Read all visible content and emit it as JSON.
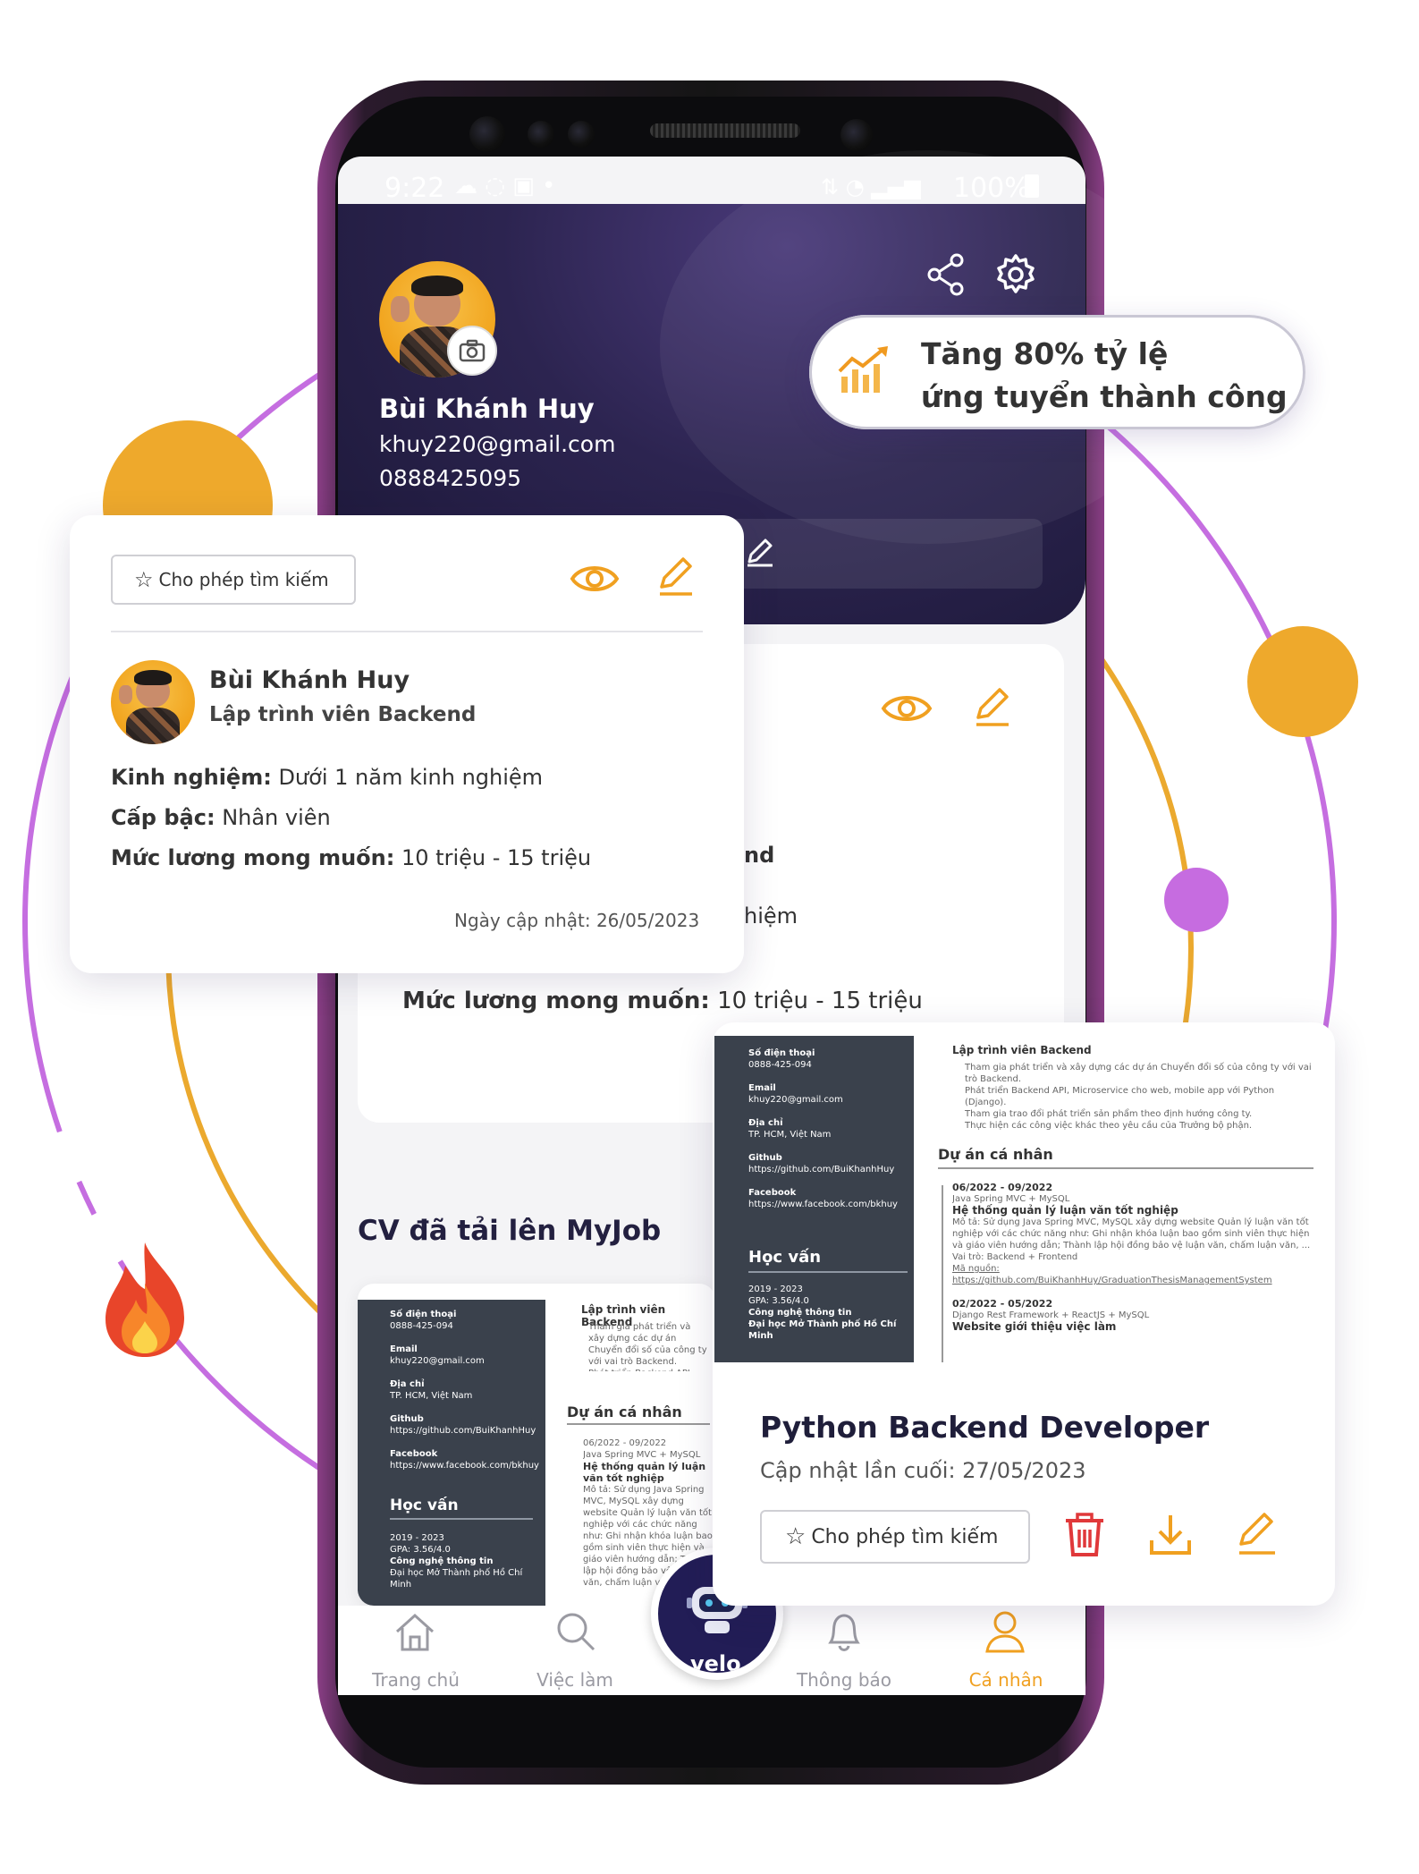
{
  "status_bar": {
    "time": "9:22",
    "right_text": "100%"
  },
  "profile_header": {
    "name": "Bùi Khánh Huy",
    "email": "khuy220@gmail.com",
    "phone": "0888425095"
  },
  "boost_badge": {
    "line1": "Tăng 80% tỷ lệ",
    "line2": "ứng tuyển thành công"
  },
  "profile_card": {
    "search_toggle_label": "Cho phép tìm kiếm",
    "name": "Bùi Khánh Huy",
    "position": "Lập trình viên Backend",
    "experience_label": "Kinh nghiệm:",
    "experience_value": "Dưới 1 năm kinh nghiệm",
    "level_label": "Cấp bậc:",
    "level_value": "Nhân viên",
    "salary_label": "Mức lương mong muốn:",
    "salary_value": "10 triệu - 15 triệu",
    "updated": "Ngày cập nhật: 26/05/2023"
  },
  "background_card": {
    "partial_text_1": "nd",
    "partial_text_2": "hiệm",
    "salary_label": "Mức lương mong muốn:",
    "salary_value": "10 triệu - 15 triệu"
  },
  "uploaded_section": {
    "title": "CV đã tải lên MyJob"
  },
  "cv_preview": {
    "sidebar": [
      {
        "label": "Số điện thoại",
        "value": "0888-425-094"
      },
      {
        "label": "Email",
        "value": "khuy220@gmail.com"
      },
      {
        "label": "Địa chỉ",
        "value": "TP. HCM, Việt Nam"
      },
      {
        "label": "Github",
        "value": "https://github.com/BuiKhanhHuy"
      },
      {
        "label": "Facebook",
        "value": "https://www.facebook.com/bkhuy"
      }
    ],
    "education_heading": "Học vấn",
    "education_years": "2019 - 2023",
    "education_gpa": "GPA: 3.56/4.0",
    "education_major": "Công nghệ thông tin",
    "education_school": "Đại học Mở Thành phố Hồ Chí Minh",
    "job_title": "Lập trình viên Backend",
    "job_bullets": [
      "Tham gia phát triển và xây dựng các dự án Chuyển đổi số của công ty với vai trò Backend.",
      "Phát triển Backend API, Microservice cho web, mobile app với Python (Django).",
      "Tham gia trao đổi phát triển sản phẩm theo định hướng công ty.",
      "Thực hiện các công việc khác theo yêu cầu của Trưởng bộ phận."
    ],
    "projects_heading": "Dự án cá nhân",
    "project1_date": "06/2022 - 09/2022",
    "project1_stack": "Java Spring MVC + MySQL",
    "project1_name": "Hệ thống quản lý luận văn tốt nghiệp",
    "project1_bullets": [
      "Mô tả: Sử dụng Java Spring MVC, MySQL xây dựng website Quản lý luận văn tốt nghiệp với các chức năng như: Ghi nhận khóa luận bao gồm sinh viên thực hiện và giáo viên hướng dẫn; Thành lập hội đồng bảo vệ luận văn, chấm luận văn, ...",
      "Vai trò: Backend + Frontend",
      "Mã nguồn: https://github.com/BuiKhanhHuy/GraduationThesisManagementSystem"
    ],
    "project2_date": "02/2022 - 05/2022",
    "project2_stack": "Django Rest Framework + ReactJS + MySQL",
    "project2_name": "Website giới thiệu việc làm"
  },
  "cv_card": {
    "title": "Python Backend Developer",
    "updated": "Cập nhật lần cuối: 27/05/2023",
    "search_toggle_label": "Cho phép tìm kiếm"
  },
  "bottom_nav": {
    "items": [
      {
        "label": "Trang chủ"
      },
      {
        "label": "Việc làm"
      },
      {
        "label": "Thông báo"
      },
      {
        "label": "Cá nhân"
      }
    ],
    "center_label": "velo"
  },
  "colors": {
    "accent": "#f0a020",
    "danger": "#e0383a",
    "header_bg": "#2c2450",
    "orbit_purple": "#c56ee0",
    "orbit_orange": "#eba92e"
  }
}
